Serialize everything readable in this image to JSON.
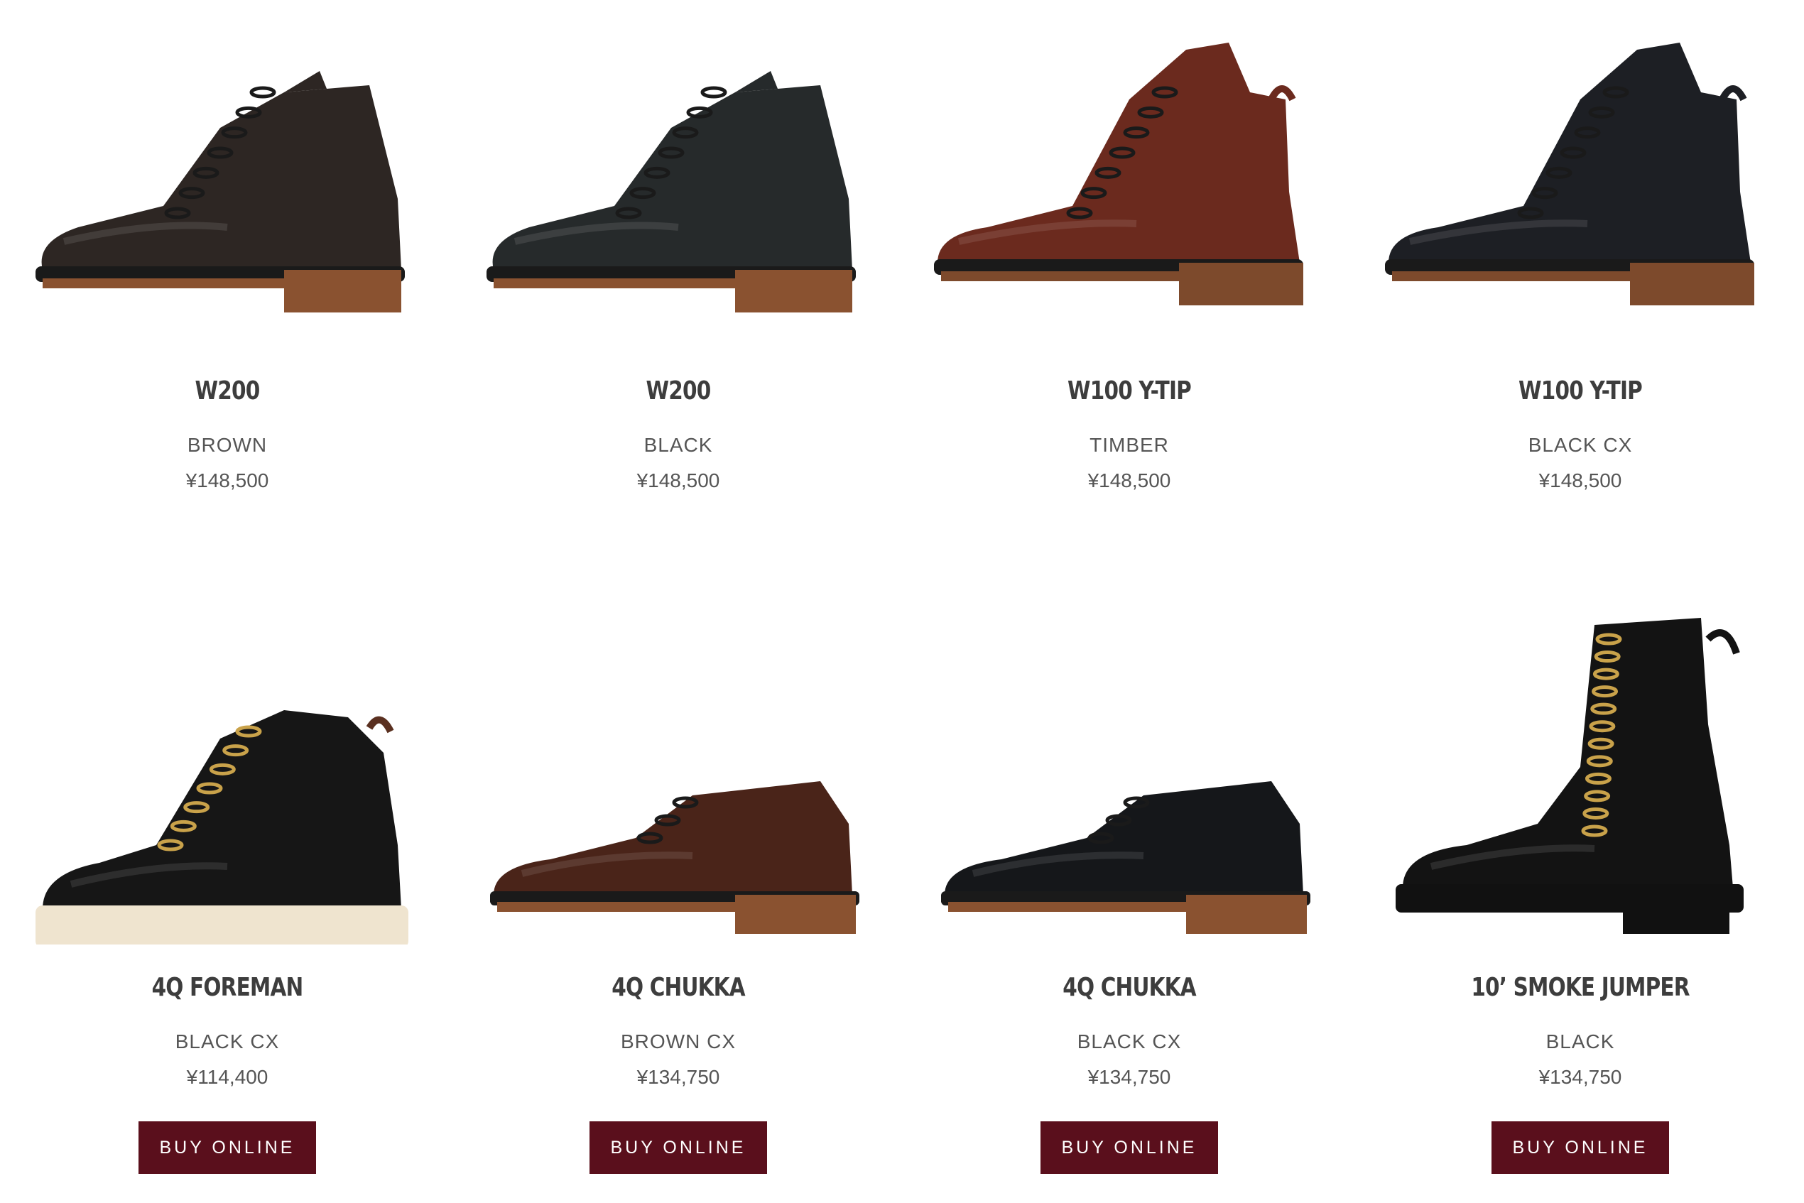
{
  "products": [
    {
      "name": "W200",
      "color": "BROWN",
      "price": "¥148,500",
      "style": "lace-boot",
      "leather": "#2d2623",
      "sole": "#8a5230"
    },
    {
      "name": "W200",
      "color": "BLACK",
      "price": "¥148,500",
      "style": "lace-boot",
      "leather": "#262a2b",
      "sole": "#8a5230"
    },
    {
      "name": "W100 Y-TIP",
      "color": "TIMBER",
      "price": "¥148,500",
      "style": "tall-boot",
      "leather": "#6b2a1e",
      "sole": "#7d4a2c"
    },
    {
      "name": "W100 Y-TIP",
      "color": "BLACK CX",
      "price": "¥148,500",
      "style": "tall-boot",
      "leather": "#1d1f24",
      "sole": "#7d4a2c"
    },
    {
      "name": "4Q FOREMAN",
      "color": "BLACK CX",
      "price": "¥114,400",
      "style": "work-boot",
      "leather": "#161616",
      "sole": "#efe4cf",
      "buy": "BUY ONLINE"
    },
    {
      "name": "4Q CHUKKA",
      "color": "BROWN CX",
      "price": "¥134,750",
      "style": "chukka",
      "leather": "#4a2419",
      "sole": "#8a5230",
      "buy": "BUY ONLINE"
    },
    {
      "name": "4Q CHUKKA",
      "color": "BLACK CX",
      "price": "¥134,750",
      "style": "chukka",
      "leather": "#15171a",
      "sole": "#8a5230",
      "buy": "BUY ONLINE"
    },
    {
      "name": "10’ SMOKE JUMPER",
      "color": "BLACK",
      "price": "¥134,750",
      "style": "smoke-jumper",
      "leather": "#131313",
      "sole": "#111111",
      "buy": "BUY ONLINE"
    }
  ],
  "colors": {
    "button_bg": "#5a0f1c",
    "name_text": "#3d3d3d",
    "meta_text": "#555555"
  }
}
